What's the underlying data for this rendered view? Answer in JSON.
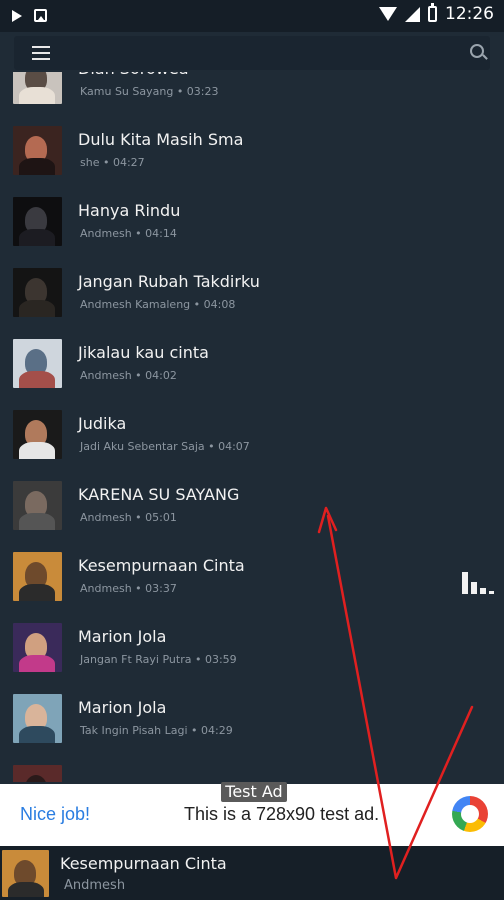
{
  "status_bar": {
    "time": "12:26"
  },
  "songs": [
    {
      "title": "Dian Sorowea",
      "subtitle": "Kamu Su Sayang • 03:23",
      "thumb": [
        "#c9c3bd",
        "#5a4d45",
        "#e8e0d6"
      ]
    },
    {
      "title": "Dulu Kita Masih Sma",
      "subtitle": "she • 04:27",
      "thumb": [
        "#3b2420",
        "#b46a52",
        "#1e1414"
      ]
    },
    {
      "title": "Hanya Rindu",
      "subtitle": "Andmesh • 04:14",
      "thumb": [
        "#0e0e10",
        "#3a3a40",
        "#1c1c22"
      ]
    },
    {
      "title": "Jangan Rubah Takdirku",
      "subtitle": "Andmesh Kamaleng • 04:08",
      "thumb": [
        "#141414",
        "#3c3530",
        "#2a2622"
      ]
    },
    {
      "title": "Jikalau kau cinta",
      "subtitle": "Andmesh • 04:02",
      "thumb": [
        "#cfd6dd",
        "#5a6f86",
        "#a44f4a"
      ]
    },
    {
      "title": "Judika",
      "subtitle": "Jadi Aku Sebentar Saja • 04:07",
      "thumb": [
        "#1a1a1a",
        "#b07a5c",
        "#e6e6e6"
      ]
    },
    {
      "title": "KARENA SU SAYANG",
      "subtitle": "Andmesh • 05:01",
      "thumb": [
        "#3b3b3b",
        "#7a6a60",
        "#555555"
      ]
    },
    {
      "title": "Kesempurnaan Cinta",
      "subtitle": "Andmesh • 03:37",
      "thumb": [
        "#c98b3a",
        "#6e4a2c",
        "#2b2b2b"
      ]
    },
    {
      "title": "Marion Jola",
      "subtitle": "Jangan Ft Rayi Putra • 03:59",
      "thumb": [
        "#3a2a5a",
        "#d0a080",
        "#c23a8a"
      ]
    },
    {
      "title": "Marion Jola",
      "subtitle": "Tak Ingin Pisah Lagi • 04:29",
      "thumb": [
        "#7fa4b8",
        "#d9b49a",
        "#2e4a5e"
      ]
    },
    {
      "title": "",
      "subtitle": "",
      "thumb": [
        "#5a2a2a",
        "#2a1a1a",
        "#3a2020"
      ]
    }
  ],
  "ad": {
    "tag": "Test Ad",
    "left_text": "Nice job!",
    "center_text": "This is a 728x90 test ad."
  },
  "player": {
    "title": "Kesempurnaan Cinta",
    "subtitle": "Andmesh",
    "thumb": [
      "#c98b3a",
      "#6e4a2c",
      "#2b2b2b"
    ]
  },
  "colors": {
    "background": "#1f2b36",
    "annotation_arrow": "#e02020"
  }
}
